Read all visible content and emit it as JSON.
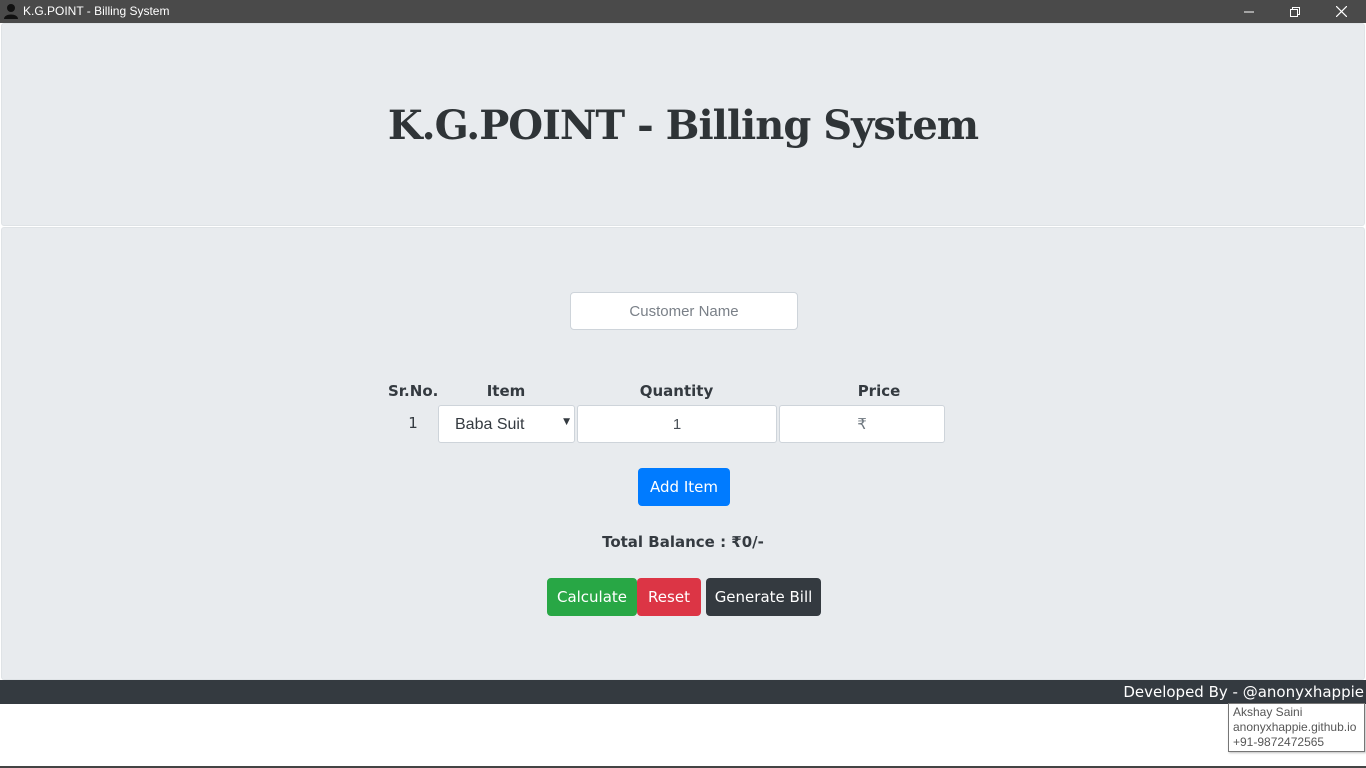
{
  "window": {
    "title": "K.G.POINT - Billing System",
    "app_icon": "user-silhouette-icon",
    "controls": {
      "minimize": "minimize-icon",
      "maximize": "restore-icon",
      "close": "close-icon"
    }
  },
  "header": {
    "title": "K.G.POINT - Billing System"
  },
  "form": {
    "customer_placeholder": "Customer Name",
    "columns": [
      "Sr.No.",
      "Item",
      "Quantity",
      "Price"
    ],
    "rows": [
      {
        "sr": "1",
        "item": "Baba Suit",
        "quantity": "1",
        "price_placeholder": "₹"
      }
    ],
    "add_item_label": "Add Item",
    "total_balance": "Total Balance : ₹0/-",
    "buttons": {
      "calculate": "Calculate",
      "reset": "Reset",
      "generate": "Generate Bill"
    }
  },
  "footer": {
    "credit": "Developed By - @anonyxhappie",
    "tooltip": [
      "Akshay Saini",
      "anonyxhappie.github.io",
      "+91-9872472565"
    ]
  },
  "colors": {
    "titlebar": "#4a4a4a",
    "panel": "#e8ebee",
    "primary": "#007bff",
    "success": "#28a745",
    "danger": "#dc3545",
    "dark": "#343a40"
  }
}
